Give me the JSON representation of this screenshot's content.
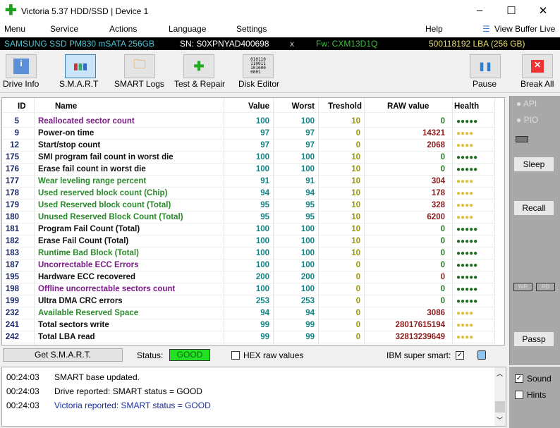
{
  "window": {
    "title": "Victoria 5.37 HDD/SSD | Device 1",
    "minimize": "–",
    "maximize": "☐",
    "close": "✕"
  },
  "menu": [
    "Menu",
    "Service",
    "Actions",
    "Language",
    "Settings",
    "Help"
  ],
  "view_buffer": "View Buffer Live",
  "device": {
    "model": "SAMSUNG SSD PM830 mSATA 256GB",
    "sn": "SN: S0XPNYAD400698",
    "x": "x",
    "fw": "Fw: CXM13D1Q",
    "lba": "500118192 LBA (256 GB)"
  },
  "toolbar": [
    "Drive Info",
    "S.M.A.R.T",
    "SMART Logs",
    "Test & Repair",
    "Disk Editor",
    "Pause",
    "Break All"
  ],
  "table": {
    "headers": [
      "ID",
      "Name",
      "Value",
      "Worst",
      "Treshold",
      "RAW value",
      "Health"
    ],
    "rows": [
      [
        "5",
        "Reallocated sector count",
        "100",
        "100",
        "10",
        "0",
        "good",
        "purple"
      ],
      [
        "9",
        "Power-on time",
        "97",
        "97",
        "0",
        "14321",
        "warn",
        "black"
      ],
      [
        "12",
        "Start/stop count",
        "97",
        "97",
        "0",
        "2068",
        "warn",
        "black"
      ],
      [
        "175",
        "SMI program fail count in worst die",
        "100",
        "100",
        "10",
        "0",
        "good",
        "black"
      ],
      [
        "176",
        "Erase fail count in worst die",
        "100",
        "100",
        "10",
        "0",
        "good",
        "black"
      ],
      [
        "177",
        "Wear leveling range percent",
        "91",
        "91",
        "10",
        "304",
        "warn",
        "green"
      ],
      [
        "178",
        "Used reserved block count (Chip)",
        "94",
        "94",
        "10",
        "178",
        "warn",
        "green"
      ],
      [
        "179",
        "Used Reserved block count (Total)",
        "95",
        "95",
        "10",
        "328",
        "warn",
        "green"
      ],
      [
        "180",
        "Unused Reserved Block Count (Total)",
        "95",
        "95",
        "10",
        "6200",
        "warn",
        "green"
      ],
      [
        "181",
        "Program Fail Count (Total)",
        "100",
        "100",
        "10",
        "0",
        "good",
        "black"
      ],
      [
        "182",
        "Erase Fail Count (Total)",
        "100",
        "100",
        "10",
        "0",
        "good",
        "black"
      ],
      [
        "183",
        "Runtime Bad Block (Total)",
        "100",
        "100",
        "10",
        "0",
        "good",
        "green"
      ],
      [
        "187",
        "Uncorrectable ECC Errors",
        "100",
        "100",
        "0",
        "0",
        "good",
        "purple"
      ],
      [
        "195",
        "Hardware ECC recovered",
        "200",
        "200",
        "0",
        "0",
        "good",
        "black"
      ],
      [
        "198",
        "Offline uncorrectable sectors count",
        "100",
        "100",
        "0",
        "0",
        "good",
        "purple"
      ],
      [
        "199",
        "Ultra DMA CRC errors",
        "253",
        "253",
        "0",
        "0",
        "good",
        "black"
      ],
      [
        "232",
        "Available Reserved Space",
        "94",
        "94",
        "0",
        "3086",
        "warn",
        "green"
      ],
      [
        "241",
        "Total sectors write",
        "99",
        "99",
        "0",
        "28017615194",
        "warn",
        "black"
      ],
      [
        "242",
        "Total LBA read",
        "99",
        "99",
        "0",
        "32813239649",
        "warn",
        "black"
      ]
    ]
  },
  "bottom": {
    "get_smart": "Get S.M.A.R.T.",
    "status_label": "Status:",
    "status": "GOOD",
    "hex": "HEX raw values",
    "ibm": "IBM super smart:",
    "check": "✓"
  },
  "log": [
    {
      "time": "00:24:03",
      "msg": "SMART base updated."
    },
    {
      "time": "00:24:03",
      "msg": "Drive reported: SMART status = GOOD"
    },
    {
      "time": "00:24:03",
      "msg": "Victoria reported: SMART status = GOOD"
    }
  ],
  "right": {
    "api": "API",
    "pio": "PIO",
    "sleep": "Sleep",
    "recall": "Recall",
    "wr": "WR",
    "rd": "RD",
    "passp": "Passp",
    "sound": "Sound",
    "hints": "Hints"
  },
  "colors": {
    "purple": "#7a1a86",
    "black": "#111111",
    "green": "#2b8a2b",
    "good": "#1f6b1f",
    "warn": "#e0c040"
  }
}
